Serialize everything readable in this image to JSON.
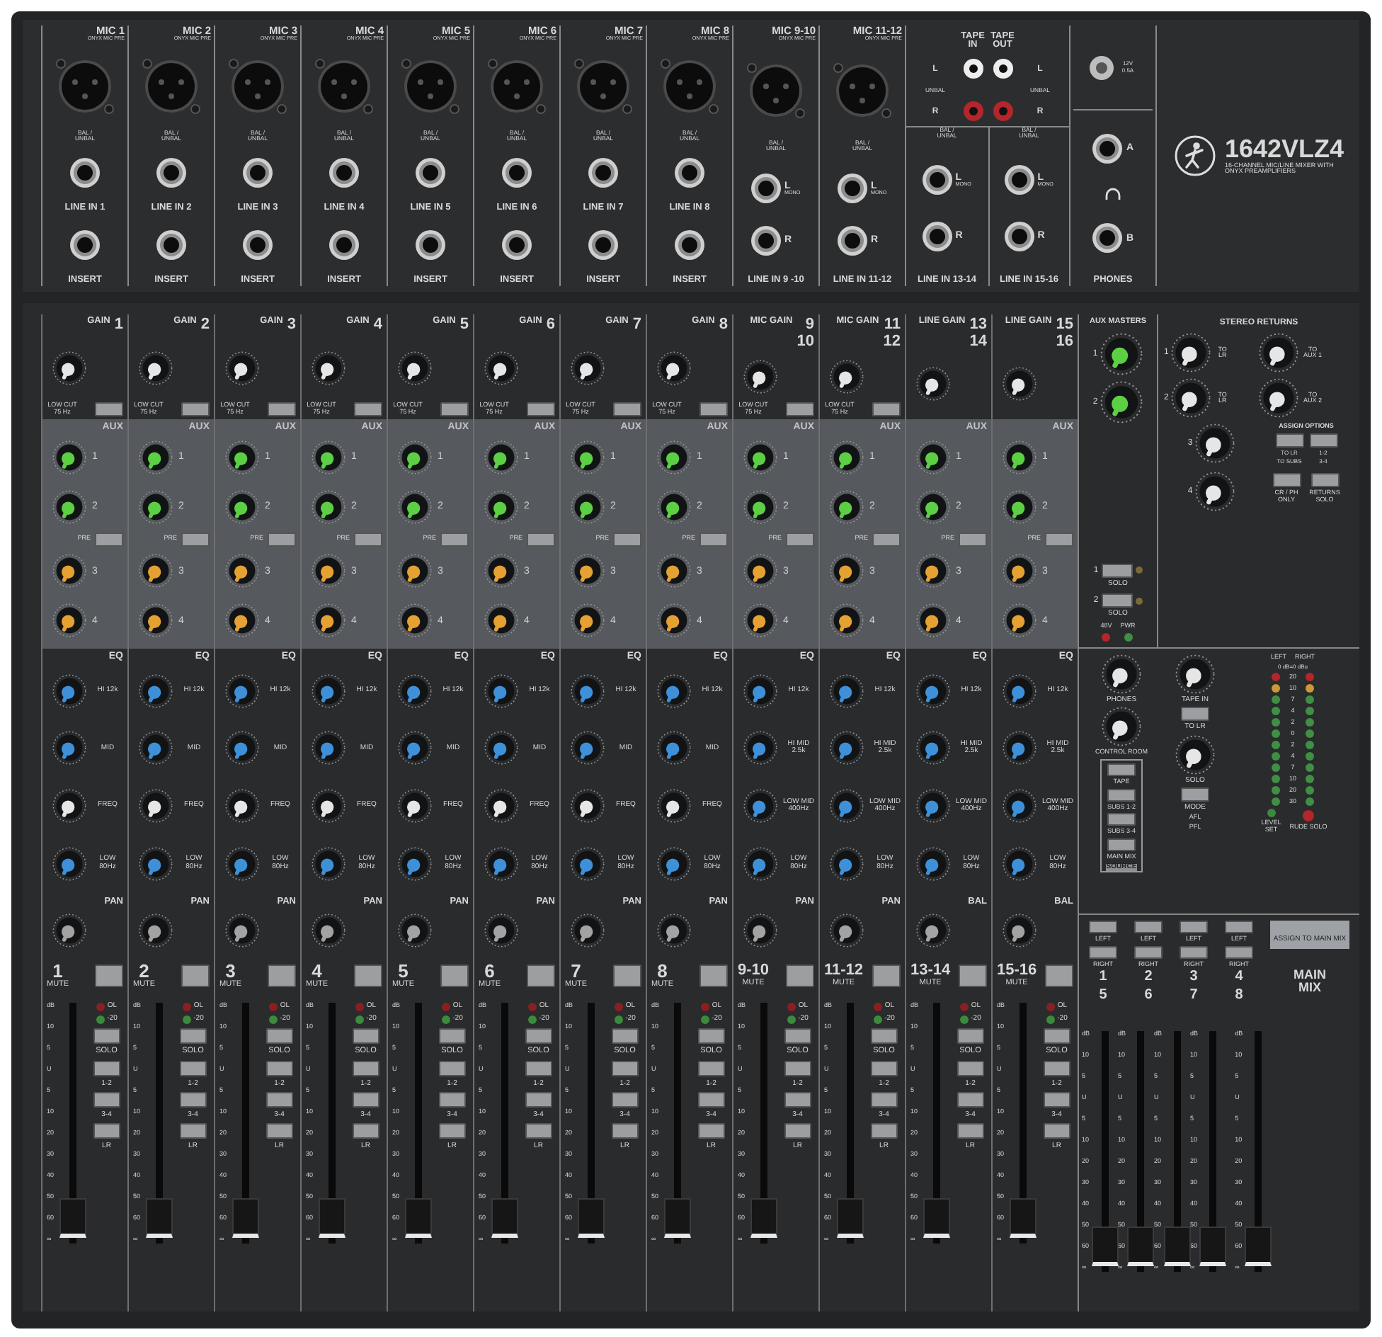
{
  "jack_panel": {
    "mono_inputs": [
      {
        "mic": "MIC 1",
        "pre": "ONYX MIC PRE",
        "bal": "BAL / UNBAL",
        "line": "LINE IN 1",
        "insert": "INSERT"
      },
      {
        "mic": "MIC 2",
        "pre": "ONYX MIC PRE",
        "bal": "BAL / UNBAL",
        "line": "LINE IN 2",
        "insert": "INSERT"
      },
      {
        "mic": "MIC 3",
        "pre": "ONYX MIC PRE",
        "bal": "BAL / UNBAL",
        "line": "LINE IN 3",
        "insert": "INSERT"
      },
      {
        "mic": "MIC 4",
        "pre": "ONYX MIC PRE",
        "bal": "BAL / UNBAL",
        "line": "LINE IN 4",
        "insert": "INSERT"
      },
      {
        "mic": "MIC 5",
        "pre": "ONYX MIC PRE",
        "bal": "BAL / UNBAL",
        "line": "LINE IN 5",
        "insert": "INSERT"
      },
      {
        "mic": "MIC 6",
        "pre": "ONYX MIC PRE",
        "bal": "BAL / UNBAL",
        "line": "LINE IN 6",
        "insert": "INSERT"
      },
      {
        "mic": "MIC 7",
        "pre": "ONYX MIC PRE",
        "bal": "BAL / UNBAL",
        "line": "LINE IN 7",
        "insert": "INSERT"
      },
      {
        "mic": "MIC 8",
        "pre": "ONYX MIC PRE",
        "bal": "BAL / UNBAL",
        "line": "LINE IN 8",
        "insert": "INSERT"
      }
    ],
    "stereo_mic_inputs": [
      {
        "mic": "MIC 9-10",
        "pre": "ONYX MIC PRE",
        "bal": "BAL / UNBAL",
        "left": "L",
        "mono": "MONO",
        "right": "R",
        "line": "LINE IN 9 -10"
      },
      {
        "mic": "MIC 11-12",
        "pre": "ONYX MIC PRE",
        "bal": "BAL / UNBAL",
        "left": "L",
        "mono": "MONO",
        "right": "R",
        "line": "LINE IN 11-12"
      }
    ],
    "tape": {
      "in": "TAPE IN",
      "out": "TAPE OUT",
      "in_labels": [
        "L",
        "UNBAL",
        "R"
      ],
      "out_labels": [
        "L",
        "UNBAL",
        "R"
      ]
    },
    "stereo_line_inputs": [
      {
        "bal": "BAL / UNBAL",
        "left": "L",
        "mono": "MONO",
        "right": "R",
        "line": "LINE IN 13-14"
      },
      {
        "bal": "BAL / UNBAL",
        "left": "L",
        "mono": "MONO",
        "right": "R",
        "line": "LINE IN 15-16"
      }
    ],
    "lamp": {
      "rating": "12V 0.5A"
    },
    "phones": {
      "a": "A",
      "b": "B",
      "label": "PHONES"
    },
    "logo": {
      "model": "1642VLZ4",
      "tagline": "16-CHANNEL MIC/LINE MIXER WITH ONYX PREAMPLIFIERS"
    }
  },
  "channels": [
    {
      "gain_label": "GAIN",
      "number": [
        "1"
      ],
      "low_cut": "LOW CUT 75 Hz",
      "aux_label": "AUX",
      "aux": [
        "1",
        "2",
        "3",
        "4"
      ],
      "pre": "PRE",
      "eq_label": "EQ",
      "eq": [
        {
          "kind": "eq",
          "label": "HI 12k"
        },
        {
          "kind": "eq",
          "label": "MID"
        },
        {
          "kind": "freq",
          "label": "FREQ"
        },
        {
          "kind": "eq",
          "label": "LOW 80Hz"
        }
      ],
      "pan_label": "PAN",
      "strip": "1",
      "mute": "MUTE",
      "ol": "OL",
      "sig": "-20",
      "solo": "SOLO",
      "assign": [
        "1-2",
        "3-4",
        "LR"
      ],
      "scale": [
        "dB",
        "10",
        "5",
        "U",
        "5",
        "10",
        "20",
        "30",
        "40",
        "50",
        "60",
        "∞"
      ],
      "level": 0.03
    },
    {
      "gain_label": "GAIN",
      "number": [
        "2"
      ],
      "low_cut": "LOW CUT 75 Hz",
      "aux_label": "AUX",
      "aux": [
        "1",
        "2",
        "3",
        "4"
      ],
      "pre": "PRE",
      "eq_label": "EQ",
      "eq": [
        {
          "kind": "eq",
          "label": "HI 12k"
        },
        {
          "kind": "eq",
          "label": "MID"
        },
        {
          "kind": "freq",
          "label": "FREQ"
        },
        {
          "kind": "eq",
          "label": "LOW 80Hz"
        }
      ],
      "pan_label": "PAN",
      "strip": "2",
      "mute": "MUTE",
      "ol": "OL",
      "sig": "-20",
      "solo": "SOLO",
      "assign": [
        "1-2",
        "3-4",
        "LR"
      ],
      "scale": [
        "dB",
        "10",
        "5",
        "U",
        "5",
        "10",
        "20",
        "30",
        "40",
        "50",
        "60",
        "∞"
      ],
      "level": 0.03
    },
    {
      "gain_label": "GAIN",
      "number": [
        "3"
      ],
      "low_cut": "LOW CUT 75 Hz",
      "aux_label": "AUX",
      "aux": [
        "1",
        "2",
        "3",
        "4"
      ],
      "pre": "PRE",
      "eq_label": "EQ",
      "eq": [
        {
          "kind": "eq",
          "label": "HI 12k"
        },
        {
          "kind": "eq",
          "label": "MID"
        },
        {
          "kind": "freq",
          "label": "FREQ"
        },
        {
          "kind": "eq",
          "label": "LOW 80Hz"
        }
      ],
      "pan_label": "PAN",
      "strip": "3",
      "mute": "MUTE",
      "ol": "OL",
      "sig": "-20",
      "solo": "SOLO",
      "assign": [
        "1-2",
        "3-4",
        "LR"
      ],
      "scale": [
        "dB",
        "10",
        "5",
        "U",
        "5",
        "10",
        "20",
        "30",
        "40",
        "50",
        "60",
        "∞"
      ],
      "level": 0.03
    },
    {
      "gain_label": "GAIN",
      "number": [
        "4"
      ],
      "low_cut": "LOW CUT 75 Hz",
      "aux_label": "AUX",
      "aux": [
        "1",
        "2",
        "3",
        "4"
      ],
      "pre": "PRE",
      "eq_label": "EQ",
      "eq": [
        {
          "kind": "eq",
          "label": "HI 12k"
        },
        {
          "kind": "eq",
          "label": "MID"
        },
        {
          "kind": "freq",
          "label": "FREQ"
        },
        {
          "kind": "eq",
          "label": "LOW 80Hz"
        }
      ],
      "pan_label": "PAN",
      "strip": "4",
      "mute": "MUTE",
      "ol": "OL",
      "sig": "-20",
      "solo": "SOLO",
      "assign": [
        "1-2",
        "3-4",
        "LR"
      ],
      "scale": [
        "dB",
        "10",
        "5",
        "U",
        "5",
        "10",
        "20",
        "30",
        "40",
        "50",
        "60",
        "∞"
      ],
      "level": 0.03
    },
    {
      "gain_label": "GAIN",
      "number": [
        "5"
      ],
      "low_cut": "LOW CUT 75 Hz",
      "aux_label": "AUX",
      "aux": [
        "1",
        "2",
        "3",
        "4"
      ],
      "pre": "PRE",
      "eq_label": "EQ",
      "eq": [
        {
          "kind": "eq",
          "label": "HI 12k"
        },
        {
          "kind": "eq",
          "label": "MID"
        },
        {
          "kind": "freq",
          "label": "FREQ"
        },
        {
          "kind": "eq",
          "label": "LOW 80Hz"
        }
      ],
      "pan_label": "PAN",
      "strip": "5",
      "mute": "MUTE",
      "ol": "OL",
      "sig": "-20",
      "solo": "SOLO",
      "assign": [
        "1-2",
        "3-4",
        "LR"
      ],
      "scale": [
        "dB",
        "10",
        "5",
        "U",
        "5",
        "10",
        "20",
        "30",
        "40",
        "50",
        "60",
        "∞"
      ],
      "level": 0.03
    },
    {
      "gain_label": "GAIN",
      "number": [
        "6"
      ],
      "low_cut": "LOW CUT 75 Hz",
      "aux_label": "AUX",
      "aux": [
        "1",
        "2",
        "3",
        "4"
      ],
      "pre": "PRE",
      "eq_label": "EQ",
      "eq": [
        {
          "kind": "eq",
          "label": "HI 12k"
        },
        {
          "kind": "eq",
          "label": "MID"
        },
        {
          "kind": "freq",
          "label": "FREQ"
        },
        {
          "kind": "eq",
          "label": "LOW 80Hz"
        }
      ],
      "pan_label": "PAN",
      "strip": "6",
      "mute": "MUTE",
      "ol": "OL",
      "sig": "-20",
      "solo": "SOLO",
      "assign": [
        "1-2",
        "3-4",
        "LR"
      ],
      "scale": [
        "dB",
        "10",
        "5",
        "U",
        "5",
        "10",
        "20",
        "30",
        "40",
        "50",
        "60",
        "∞"
      ],
      "level": 0.03
    },
    {
      "gain_label": "GAIN",
      "number": [
        "7"
      ],
      "low_cut": "LOW CUT 75 Hz",
      "aux_label": "AUX",
      "aux": [
        "1",
        "2",
        "3",
        "4"
      ],
      "pre": "PRE",
      "eq_label": "EQ",
      "eq": [
        {
          "kind": "eq",
          "label": "HI 12k"
        },
        {
          "kind": "eq",
          "label": "MID"
        },
        {
          "kind": "freq",
          "label": "FREQ"
        },
        {
          "kind": "eq",
          "label": "LOW 80Hz"
        }
      ],
      "pan_label": "PAN",
      "strip": "7",
      "mute": "MUTE",
      "ol": "OL",
      "sig": "-20",
      "solo": "SOLO",
      "assign": [
        "1-2",
        "3-4",
        "LR"
      ],
      "scale": [
        "dB",
        "10",
        "5",
        "U",
        "5",
        "10",
        "20",
        "30",
        "40",
        "50",
        "60",
        "∞"
      ],
      "level": 0.03
    },
    {
      "gain_label": "GAIN",
      "number": [
        "8"
      ],
      "low_cut": "LOW CUT 75 Hz",
      "aux_label": "AUX",
      "aux": [
        "1",
        "2",
        "3",
        "4"
      ],
      "pre": "PRE",
      "eq_label": "EQ",
      "eq": [
        {
          "kind": "eq",
          "label": "HI 12k"
        },
        {
          "kind": "eq",
          "label": "MID"
        },
        {
          "kind": "freq",
          "label": "FREQ"
        },
        {
          "kind": "eq",
          "label": "LOW 80Hz"
        }
      ],
      "pan_label": "PAN",
      "strip": "8",
      "mute": "MUTE",
      "ol": "OL",
      "sig": "-20",
      "solo": "SOLO",
      "assign": [
        "1-2",
        "3-4",
        "LR"
      ],
      "scale": [
        "dB",
        "10",
        "5",
        "U",
        "5",
        "10",
        "20",
        "30",
        "40",
        "50",
        "60",
        "∞"
      ],
      "level": 0.03
    },
    {
      "gain_label": "MIC GAIN",
      "number": [
        "9",
        "10"
      ],
      "low_cut": "LOW CUT 75 Hz",
      "aux_label": "AUX",
      "aux": [
        "1",
        "2",
        "3",
        "4"
      ],
      "pre": "PRE",
      "eq_label": "EQ",
      "eq": [
        {
          "kind": "eq",
          "label": "HI 12k"
        },
        {
          "kind": "eq",
          "label": "HI MID 2.5k"
        },
        {
          "kind": "eq",
          "label": "LOW MID 400Hz"
        },
        {
          "kind": "eq",
          "label": "LOW 80Hz"
        }
      ],
      "pan_label": "PAN",
      "strip": "9-10",
      "mute": "MUTE",
      "ol": "OL",
      "sig": "-20",
      "solo": "SOLO",
      "assign": [
        "1-2",
        "3-4",
        "LR"
      ],
      "scale": [
        "dB",
        "10",
        "5",
        "U",
        "5",
        "10",
        "20",
        "30",
        "40",
        "50",
        "60",
        "∞"
      ],
      "level": 0.03
    },
    {
      "gain_label": "MIC GAIN",
      "number": [
        "11",
        "12"
      ],
      "low_cut": "LOW CUT 75 Hz",
      "aux_label": "AUX",
      "aux": [
        "1",
        "2",
        "3",
        "4"
      ],
      "pre": "PRE",
      "eq_label": "EQ",
      "eq": [
        {
          "kind": "eq",
          "label": "HI 12k"
        },
        {
          "kind": "eq",
          "label": "HI MID 2.5k"
        },
        {
          "kind": "eq",
          "label": "LOW MID 400Hz"
        },
        {
          "kind": "eq",
          "label": "LOW 80Hz"
        }
      ],
      "pan_label": "PAN",
      "strip": "11-12",
      "mute": "MUTE",
      "ol": "OL",
      "sig": "-20",
      "solo": "SOLO",
      "assign": [
        "1-2",
        "3-4",
        "LR"
      ],
      "scale": [
        "dB",
        "10",
        "5",
        "U",
        "5",
        "10",
        "20",
        "30",
        "40",
        "50",
        "60",
        "∞"
      ],
      "level": 0.03
    },
    {
      "gain_label": "LINE GAIN",
      "number": [
        "13",
        "14"
      ],
      "aux_label": "AUX",
      "aux": [
        "1",
        "2",
        "3",
        "4"
      ],
      "pre": "PRE",
      "eq_label": "EQ",
      "eq": [
        {
          "kind": "eq",
          "label": "HI 12k"
        },
        {
          "kind": "eq",
          "label": "HI MID 2.5k"
        },
        {
          "kind": "eq",
          "label": "LOW MID 400Hz"
        },
        {
          "kind": "eq",
          "label": "LOW 80Hz"
        }
      ],
      "pan_label": "BAL",
      "strip": "13-14",
      "mute": "MUTE",
      "ol": "OL",
      "sig": "-20",
      "solo": "SOLO",
      "assign": [
        "1-2",
        "3-4",
        "LR"
      ],
      "scale": [
        "dB",
        "10",
        "5",
        "U",
        "5",
        "10",
        "20",
        "30",
        "40",
        "50",
        "60",
        "∞"
      ],
      "level": 0.03
    },
    {
      "gain_label": "LINE GAIN",
      "number": [
        "15",
        "16"
      ],
      "aux_label": "AUX",
      "aux": [
        "1",
        "2",
        "3",
        "4"
      ],
      "pre": "PRE",
      "eq_label": "EQ",
      "eq": [
        {
          "kind": "eq",
          "label": "HI 12k"
        },
        {
          "kind": "eq",
          "label": "HI MID 2.5k"
        },
        {
          "kind": "eq",
          "label": "LOW MID 400Hz"
        },
        {
          "kind": "eq",
          "label": "LOW 80Hz"
        }
      ],
      "pan_label": "BAL",
      "strip": "15-16",
      "mute": "MUTE",
      "ol": "OL",
      "sig": "-20",
      "solo": "SOLO",
      "assign": [
        "1-2",
        "3-4",
        "LR"
      ],
      "scale": [
        "dB",
        "10",
        "5",
        "U",
        "5",
        "10",
        "20",
        "30",
        "40",
        "50",
        "60",
        "∞"
      ],
      "level": 0.03
    }
  ],
  "aux_masters": {
    "title": "AUX MASTERS",
    "sends": [
      "1",
      "2"
    ],
    "solos": [
      {
        "number": "1",
        "label": "SOLO"
      },
      {
        "number": "2",
        "label": "SOLO"
      }
    ],
    "indicators": [
      {
        "label": "48V",
        "color": "#b3262b"
      },
      {
        "label": "PWR",
        "color": "#3f8f45"
      }
    ]
  },
  "stereo_returns": {
    "title": "STEREO RETURNS",
    "returns": [
      {
        "number": "1",
        "to_lr": "TO LR",
        "to_aux": "TO AUX 1"
      },
      {
        "number": "2",
        "to_lr": "TO LR",
        "to_aux": "TO AUX 2"
      }
    ],
    "extra": [
      "3",
      "4"
    ],
    "assign_title": "ASSIGN OPTIONS",
    "assign_buttons": [
      {
        "options": [
          "TO LR",
          "TO SUBS"
        ]
      },
      {
        "options": [
          "1-2",
          "3-4"
        ]
      }
    ],
    "cr_ph": "CR / PH ONLY",
    "returns_solo": "RETURNS SOLO"
  },
  "control_room": {
    "phones": "PHONES",
    "tape_in": "TAPE IN",
    "control_room": "CONTROL ROOM",
    "to_lr": "TO LR",
    "sources": [
      "TAPE",
      "SUBS 1-2",
      "SUBS 3-4",
      "MAIN MIX"
    ],
    "source_title": "SOURCE",
    "solo": "SOLO",
    "mode": "MODE",
    "mode_options": [
      "AFL",
      "PFL"
    ],
    "level_set": "LEVEL SET",
    "rude_solo": "RUDE SOLO"
  },
  "meter": {
    "left": "LEFT",
    "right": "RIGHT",
    "reference": "0 dB=0 dBu",
    "rows": [
      {
        "label": "20",
        "color": "#b3262b"
      },
      {
        "label": "10",
        "color": "#c99a35"
      },
      {
        "label": "7",
        "color": "#3f8f45"
      },
      {
        "label": "4",
        "color": "#3f8f45"
      },
      {
        "label": "2",
        "color": "#3f8f45"
      },
      {
        "label": "0",
        "color": "#3f8f45"
      },
      {
        "label": "2",
        "color": "#3f8f45"
      },
      {
        "label": "4",
        "color": "#3f8f45"
      },
      {
        "label": "7",
        "color": "#3f8f45"
      },
      {
        "label": "10",
        "color": "#3f8f45"
      },
      {
        "label": "20",
        "color": "#3f8f45"
      },
      {
        "label": "30",
        "color": "#3f8f45"
      }
    ]
  },
  "subgroups": {
    "assign_title": "ASSIGN TO MAIN MIX",
    "groups": [
      {
        "left": "LEFT",
        "right": "RIGHT",
        "number": "1",
        "number2": "5",
        "scale": [
          "dB",
          "10",
          "5",
          "U",
          "5",
          "10",
          "20",
          "30",
          "40",
          "50",
          "60",
          "∞"
        ],
        "level": 0.03
      },
      {
        "left": "LEFT",
        "right": "RIGHT",
        "number": "2",
        "number2": "6",
        "scale": [
          "dB",
          "10",
          "5",
          "U",
          "5",
          "10",
          "20",
          "30",
          "40",
          "50",
          "60",
          "∞"
        ],
        "level": 0.03
      },
      {
        "left": "LEFT",
        "right": "RIGHT",
        "number": "3",
        "number2": "7",
        "scale": [
          "dB",
          "10",
          "5",
          "U",
          "5",
          "10",
          "20",
          "30",
          "40",
          "50",
          "60",
          "∞"
        ],
        "level": 0.03
      },
      {
        "left": "LEFT",
        "right": "RIGHT",
        "number": "4",
        "number2": "8",
        "scale": [
          "dB",
          "10",
          "5",
          "U",
          "5",
          "10",
          "20",
          "30",
          "40",
          "50",
          "60",
          "∞"
        ],
        "level": 0.03
      }
    ],
    "main": {
      "label": "MAIN MIX",
      "scale": [
        "dB",
        "10",
        "5",
        "U",
        "5",
        "10",
        "20",
        "30",
        "40",
        "50",
        "60",
        "∞"
      ],
      "level": 0.03
    }
  }
}
